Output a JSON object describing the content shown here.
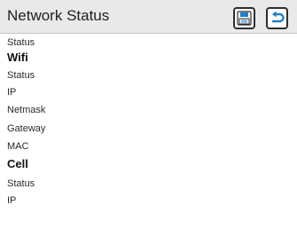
{
  "header": {
    "title": "Network Status",
    "save_icon": "save-disk-icon",
    "back_icon": "back-arrow-icon"
  },
  "rows": [
    {
      "label": "Status",
      "type": "item"
    },
    {
      "label": "Wifi",
      "type": "section"
    },
    {
      "label": "Status",
      "type": "item"
    },
    {
      "label": "IP",
      "type": "item"
    },
    {
      "label": "Netmask",
      "type": "item"
    },
    {
      "label": "Gateway",
      "type": "item"
    },
    {
      "label": "MAC",
      "type": "item"
    },
    {
      "label": "Cell",
      "type": "section"
    },
    {
      "label": "Status",
      "type": "item"
    },
    {
      "label": "IP",
      "type": "item"
    }
  ],
  "colors": {
    "header_bg": "#e9e9e9",
    "accent_blue": "#1f7ec8",
    "text": "#222222"
  }
}
